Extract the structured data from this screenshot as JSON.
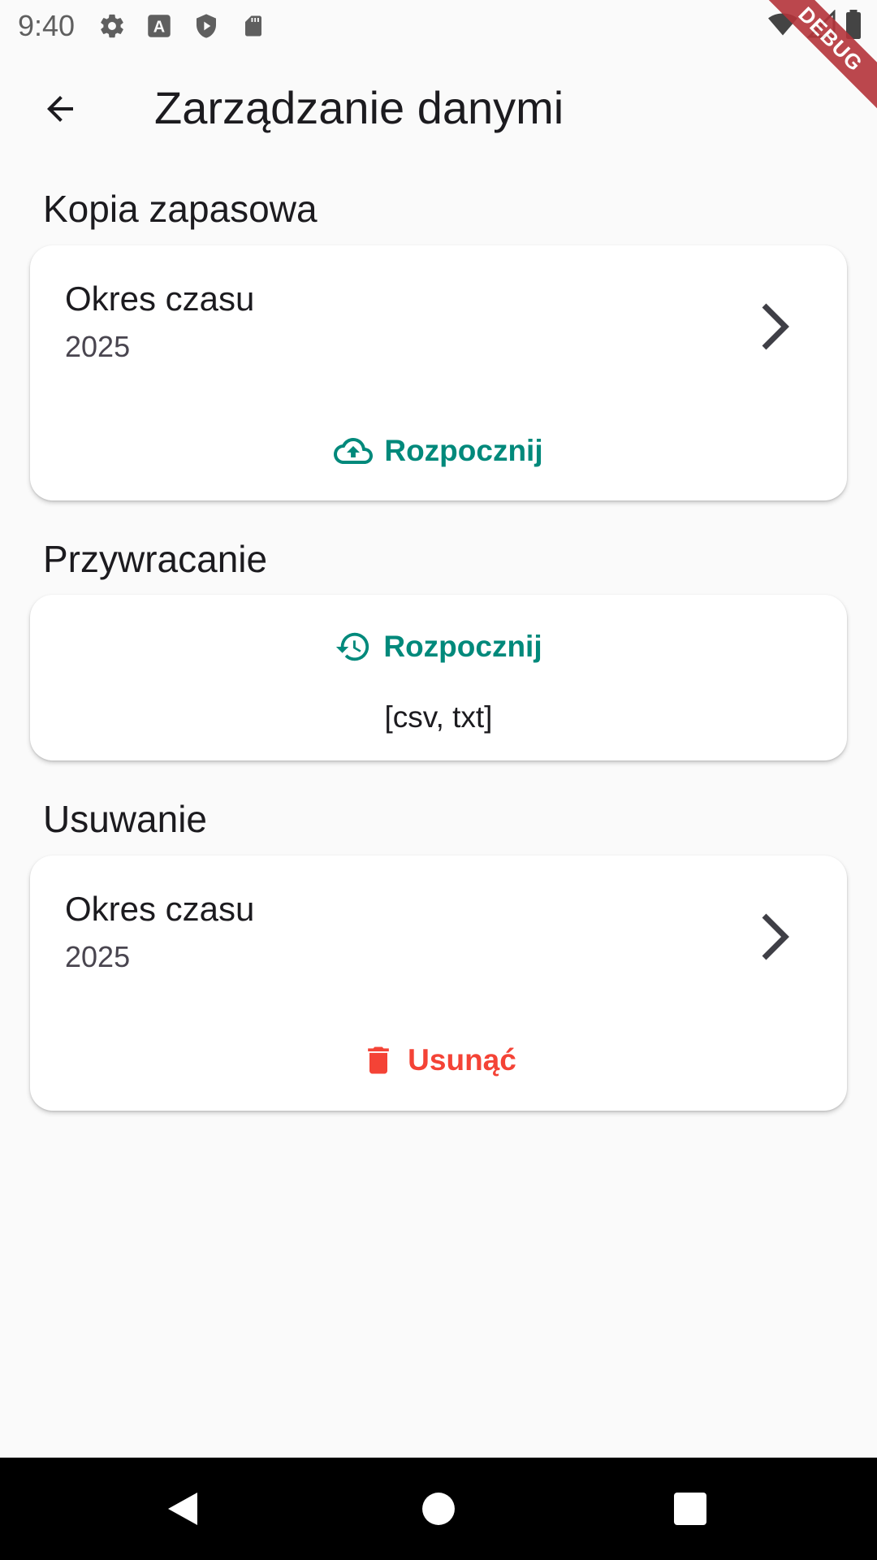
{
  "status_bar": {
    "time": "9:40",
    "icons": [
      "gear-icon",
      "text-a-icon",
      "shield-play-icon",
      "sd-card-icon",
      "wifi-icon",
      "signal-icon",
      "battery-icon"
    ],
    "debug_label": "DEBUG"
  },
  "app_bar": {
    "back_icon": "arrow-back-icon",
    "title": "Zarządzanie danymi"
  },
  "sections": {
    "backup": {
      "title": "Kopia zapasowa",
      "period_label": "Okres czasu",
      "period_value": "2025",
      "action_label": "Rozpocznij",
      "action_icon": "cloud-upload-icon"
    },
    "restore": {
      "title": "Przywracanie",
      "action_label": "Rozpocznij",
      "action_icon": "history-icon",
      "formats": "[csv, txt]"
    },
    "delete": {
      "title": "Usuwanie",
      "period_label": "Okres czasu",
      "period_value": "2025",
      "action_label": "Usunąć",
      "action_icon": "trash-icon"
    }
  },
  "colors": {
    "accent": "#00897b",
    "danger": "#f44336",
    "background": "#fafafa",
    "card": "#ffffff"
  },
  "nav_bar": {
    "icons": [
      "back-triangle-icon",
      "home-circle-icon",
      "recents-square-icon"
    ]
  }
}
